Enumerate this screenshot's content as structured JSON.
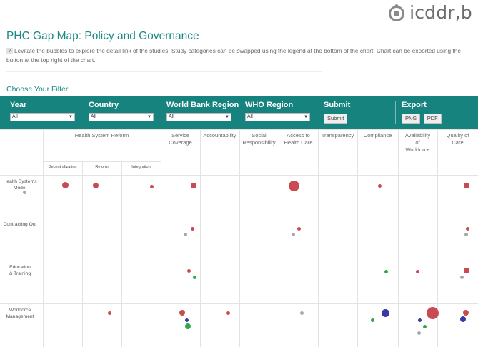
{
  "brand": {
    "name": "icddr,b"
  },
  "page": {
    "title": "PHC Gap Map: Policy and Governance",
    "help_text": "Levitate the bubbles to explore the detail link of the studies. Study categories can be swapped using the legend at the bottom of the chart. Chart can be exported using the button at the top right of the chart.",
    "help_icon": "?",
    "filter_title": "Choose Your Filter"
  },
  "filters": {
    "year": {
      "label": "Year",
      "value": "All"
    },
    "country": {
      "label": "Country",
      "value": "All"
    },
    "wb_region": {
      "label": "World Bank Region",
      "value": "All"
    },
    "who_region": {
      "label": "WHO Region",
      "value": "All"
    },
    "submit": {
      "label": "Submit",
      "button": "Submit"
    },
    "export": {
      "label": "Export",
      "png": "PNG",
      "pdf": "PDF"
    }
  },
  "colors": {
    "teal": "#16837f",
    "red": "#c94a52",
    "gray": "#a8a8a8",
    "blue": "#3a3aa5",
    "green": "#2ea84a"
  },
  "gap_map": {
    "group_header": "Health System Reform",
    "sub_headers": [
      "Decentralization",
      "Reform",
      "Integration"
    ],
    "columns": [
      "Service Coverage",
      "Accountability",
      "Social Responsibility",
      "Access to Health Care",
      "Transparency",
      "Compliance",
      "Availability of Workforce",
      "Quality of Care"
    ],
    "rows": [
      "Health Systems Model",
      "Contracting Out",
      "Education & Training",
      "Workforce Management"
    ],
    "bubbles": [
      {
        "row": 0,
        "col": 0,
        "color": "red",
        "size": 9
      },
      {
        "row": 0,
        "col": 0,
        "color": "gray",
        "size": 5
      },
      {
        "row": 0,
        "col": 1,
        "color": "red",
        "size": 8
      },
      {
        "row": 0,
        "col": 2,
        "color": "red",
        "size": 5
      },
      {
        "row": 0,
        "col": 3,
        "color": "red",
        "size": 8
      },
      {
        "row": 0,
        "col": 6,
        "color": "red",
        "size": 15
      },
      {
        "row": 0,
        "col": 8,
        "color": "red",
        "size": 5
      },
      {
        "row": 0,
        "col": 10,
        "color": "red",
        "size": 8
      },
      {
        "row": 1,
        "col": 3,
        "color": "red",
        "size": 5
      },
      {
        "row": 1,
        "col": 3,
        "color": "gray",
        "size": 5
      },
      {
        "row": 1,
        "col": 6,
        "color": "red",
        "size": 5
      },
      {
        "row": 1,
        "col": 6,
        "color": "gray",
        "size": 5
      },
      {
        "row": 1,
        "col": 10,
        "color": "red",
        "size": 5
      },
      {
        "row": 1,
        "col": 10,
        "color": "gray",
        "size": 5
      },
      {
        "row": 2,
        "col": 3,
        "color": "red",
        "size": 5
      },
      {
        "row": 2,
        "col": 3,
        "color": "green",
        "size": 5
      },
      {
        "row": 2,
        "col": 8,
        "color": "green",
        "size": 5
      },
      {
        "row": 2,
        "col": 9,
        "color": "red",
        "size": 5
      },
      {
        "row": 2,
        "col": 10,
        "color": "red",
        "size": 8
      },
      {
        "row": 2,
        "col": 10,
        "color": "gray",
        "size": 5
      },
      {
        "row": 3,
        "col": 1,
        "color": "red",
        "size": 5
      },
      {
        "row": 3,
        "col": 3,
        "color": "red",
        "size": 8
      },
      {
        "row": 3,
        "col": 3,
        "color": "blue",
        "size": 5
      },
      {
        "row": 3,
        "col": 3,
        "color": "green",
        "size": 8
      },
      {
        "row": 3,
        "col": 4,
        "color": "red",
        "size": 5
      },
      {
        "row": 3,
        "col": 6,
        "color": "gray",
        "size": 5
      },
      {
        "row": 3,
        "col": 8,
        "color": "blue",
        "size": 11
      },
      {
        "row": 3,
        "col": 8,
        "color": "green",
        "size": 5
      },
      {
        "row": 3,
        "col": 9,
        "color": "red",
        "size": 17
      },
      {
        "row": 3,
        "col": 9,
        "color": "blue",
        "size": 5
      },
      {
        "row": 3,
        "col": 9,
        "color": "green",
        "size": 5
      },
      {
        "row": 3,
        "col": 9,
        "color": "gray",
        "size": 5
      },
      {
        "row": 3,
        "col": 10,
        "color": "red",
        "size": 8
      },
      {
        "row": 3,
        "col": 10,
        "color": "blue",
        "size": 8
      }
    ]
  }
}
